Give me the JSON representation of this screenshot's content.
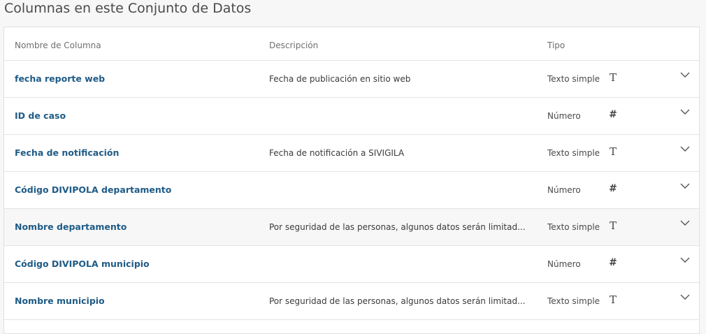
{
  "page_title": "Columnas en este Conjunto de Datos",
  "table": {
    "headers": {
      "name": "Nombre de Columna",
      "description": "Descripción",
      "type": "Tipo"
    },
    "rows": [
      {
        "name": "fecha reporte web",
        "description": "Fecha de publicación en sitio web",
        "type": "Texto simple",
        "type_icon": "T",
        "icon_name": "text-type-icon"
      },
      {
        "name": "ID de caso",
        "description": "",
        "type": "Número",
        "type_icon": "#",
        "icon_name": "number-type-icon"
      },
      {
        "name": "Fecha de notificación",
        "description": "Fecha de notificación a SIVIGILA",
        "type": "Texto simple",
        "type_icon": "T",
        "icon_name": "text-type-icon"
      },
      {
        "name": "Código DIVIPOLA departamento",
        "description": "",
        "type": "Número",
        "type_icon": "#",
        "icon_name": "number-type-icon"
      },
      {
        "name": "Nombre departamento",
        "description": "Por seguridad de las personas, algunos datos serán limitad...",
        "type": "Texto simple",
        "type_icon": "T",
        "icon_name": "text-type-icon"
      },
      {
        "name": "Código DIVIPOLA municipio",
        "description": "",
        "type": "Número",
        "type_icon": "#",
        "icon_name": "number-type-icon"
      },
      {
        "name": "Nombre municipio",
        "description": "Por seguridad de las personas, algunos datos serán limitad...",
        "type": "Texto simple",
        "type_icon": "T",
        "icon_name": "text-type-icon"
      }
    ]
  },
  "colors": {
    "link": "#1f5b86",
    "row_highlight": "#f7f7f7",
    "border": "#e3e3e3"
  }
}
